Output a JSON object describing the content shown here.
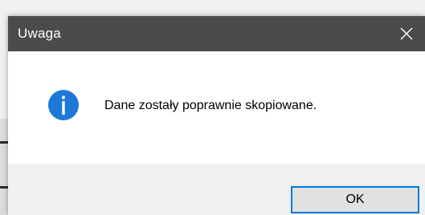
{
  "dialog": {
    "title": "Uwaga",
    "message": "Dane zostały poprawnie skopiowane.",
    "ok_label": "OK",
    "icon": "info-icon",
    "close_icon": "close-icon"
  },
  "colors": {
    "titlebar": "#4b4b4b",
    "title_text": "#ffffff",
    "content_bg": "#ffffff",
    "footer_bg": "#f0f0f0",
    "icon_blue": "#1e78d7",
    "button_border": "#0078d7",
    "button_bg": "#e1e1e1"
  }
}
